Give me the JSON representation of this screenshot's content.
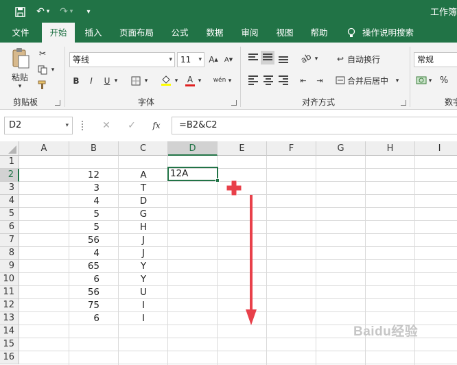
{
  "titlebar": {
    "title": "工作簿"
  },
  "tabs": [
    "文件",
    "开始",
    "插入",
    "页面布局",
    "公式",
    "数据",
    "审阅",
    "视图",
    "帮助",
    "操作说明搜索"
  ],
  "ribbon": {
    "paste_label": "粘贴",
    "font_name": "等线",
    "font_size": "11",
    "wrap_text": "自动换行",
    "merge_center": "合并后居中",
    "number_format": "常规",
    "groups": {
      "clipboard": "剪贴板",
      "font": "字体",
      "alignment": "对齐方式",
      "number": "数字"
    }
  },
  "formula_bar": {
    "name_box": "D2",
    "formula": "=B2&C2"
  },
  "columns": [
    "A",
    "B",
    "C",
    "D",
    "E",
    "F",
    "G",
    "H",
    "I"
  ],
  "rows": [
    "1",
    "2",
    "3",
    "4",
    "5",
    "6",
    "7",
    "8",
    "9",
    "10",
    "11",
    "12",
    "13",
    "14",
    "15",
    "16"
  ],
  "cells": {
    "B": [
      "",
      "12",
      "3",
      "4",
      "5",
      "5",
      "56",
      "4",
      "65",
      "6",
      "56",
      "75",
      "6",
      "",
      "",
      ""
    ],
    "C": [
      "",
      "A",
      "T",
      "D",
      "G",
      "H",
      "J",
      "J",
      "Y",
      "Y",
      "U",
      "I",
      "I",
      "",
      "",
      ""
    ],
    "D2": "12A"
  },
  "selected_cell": "D2",
  "accent": "#217346",
  "annotation_color": "#e8404a",
  "watermark": "Baidu经验"
}
